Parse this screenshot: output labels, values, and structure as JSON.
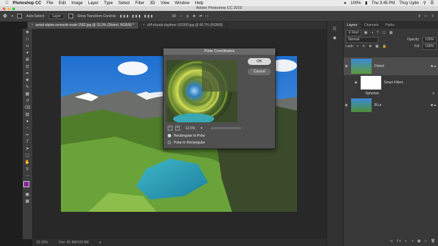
{
  "menubar": {
    "app": "Photoshop CC",
    "items": [
      "File",
      "Edit",
      "Image",
      "Layer",
      "Type",
      "Select",
      "Filter",
      "3D",
      "View",
      "Window",
      "Help"
    ],
    "battery": "100%",
    "time": "Thu 3:45 PM",
    "user": "Thùy Uyên"
  },
  "window": {
    "title": "Adobe Photoshop CC 2019"
  },
  "options": {
    "auto_select": "Auto-Select:",
    "auto_select_value": "Layer",
    "show_transform": "Show Transform Controls"
  },
  "tabs": [
    {
      "label": "aerial-alpine-ceresole-reale-1562.jpg @ 33.3% (Distort, RGB/8) *"
    },
    {
      "label": "cliff-clouds-daytime-161900.jpg @ 66.7% (RGB/8)"
    }
  ],
  "status": {
    "zoom": "33.33%",
    "doc": "Doc: 81.9M/103.5M"
  },
  "dialog": {
    "title": "Polar Coordinates",
    "ok": "OK",
    "cancel": "Cancel",
    "zoom": "12.5%",
    "option1": "Rectangular to Polar",
    "option2": "Polar to Rectangular",
    "selected": "Rectangular to Polar"
  },
  "panel": {
    "tabs": [
      "Layers",
      "Channels",
      "Paths"
    ],
    "kind": "Kind",
    "blend": "Normal",
    "opacity_label": "Opacity:",
    "opacity": "100%",
    "lock_label": "Lock:",
    "fill_label": "Fill:",
    "fill": "100%",
    "layers": [
      {
        "name": "Distort"
      },
      {
        "name": "Smart Filters"
      },
      {
        "name": "Spherize"
      },
      {
        "name": "BLur"
      }
    ]
  },
  "colors": {
    "accent": "#4a90e2",
    "foreground_swatch": "#8a1f9c",
    "dialog_button": "#d9d9d9"
  }
}
